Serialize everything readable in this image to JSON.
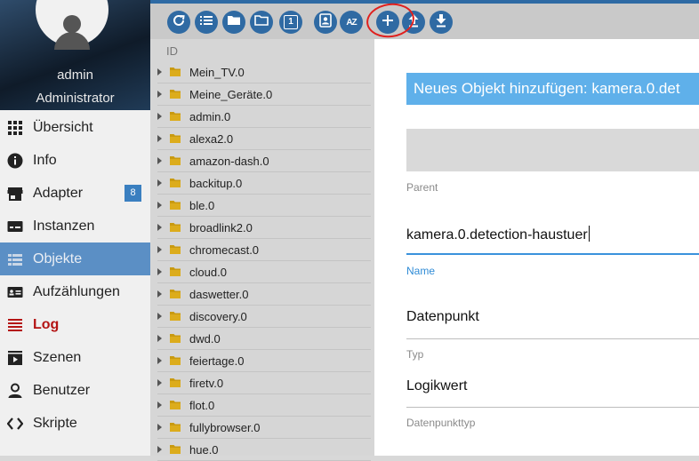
{
  "user": {
    "name": "admin",
    "role": "Administrator"
  },
  "nav": {
    "items": [
      {
        "label": "Übersicht",
        "icon": "grid-icon"
      },
      {
        "label": "Info",
        "icon": "info-icon"
      },
      {
        "label": "Adapter",
        "icon": "store-icon",
        "badge": "8"
      },
      {
        "label": "Instanzen",
        "icon": "instances-icon"
      },
      {
        "label": "Objekte",
        "icon": "list-icon"
      },
      {
        "label": "Aufzählungen",
        "icon": "enum-icon"
      },
      {
        "label": "Log",
        "icon": "log-icon"
      },
      {
        "label": "Szenen",
        "icon": "scenes-icon"
      },
      {
        "label": "Benutzer",
        "icon": "user-icon"
      },
      {
        "label": "Skripte",
        "icon": "code-icon"
      }
    ]
  },
  "toolbar": {
    "buttons": [
      "refresh-icon",
      "list-view-icon",
      "folder-icon",
      "folder-open-icon",
      "one-icon",
      "contact-icon",
      "sort-az-icon",
      "plus-icon",
      "upload-icon",
      "download-icon"
    ],
    "sort_label": "AZ",
    "one_label": "1"
  },
  "tree": {
    "header": "ID",
    "rows": [
      "Mein_TV.0",
      "Meine_Geräte.0",
      "admin.0",
      "alexa2.0",
      "amazon-dash.0",
      "backitup.0",
      "ble.0",
      "broadlink2.0",
      "chromecast.0",
      "cloud.0",
      "daswetter.0",
      "discovery.0",
      "dwd.0",
      "feiertage.0",
      "firetv.0",
      "flot.0",
      "fullybrowser.0",
      "hue.0"
    ]
  },
  "dialog": {
    "title": "Neues Objekt hinzufügen: kamera.0.det",
    "parent_label": "Parent",
    "name_value": "kamera.0.detection-haustuer",
    "name_label": "Name",
    "type_value": "Datenpunkt",
    "type_label": "Typ",
    "datatype_value": "Logikwert",
    "datatype_label": "Datenpunkttyp"
  },
  "colors": {
    "accent": "#2f6aa3",
    "active_nav": "#5b8fc5",
    "dialog_title": "#5fb0ea",
    "log": "#b41414",
    "highlight": "#e0201e"
  }
}
